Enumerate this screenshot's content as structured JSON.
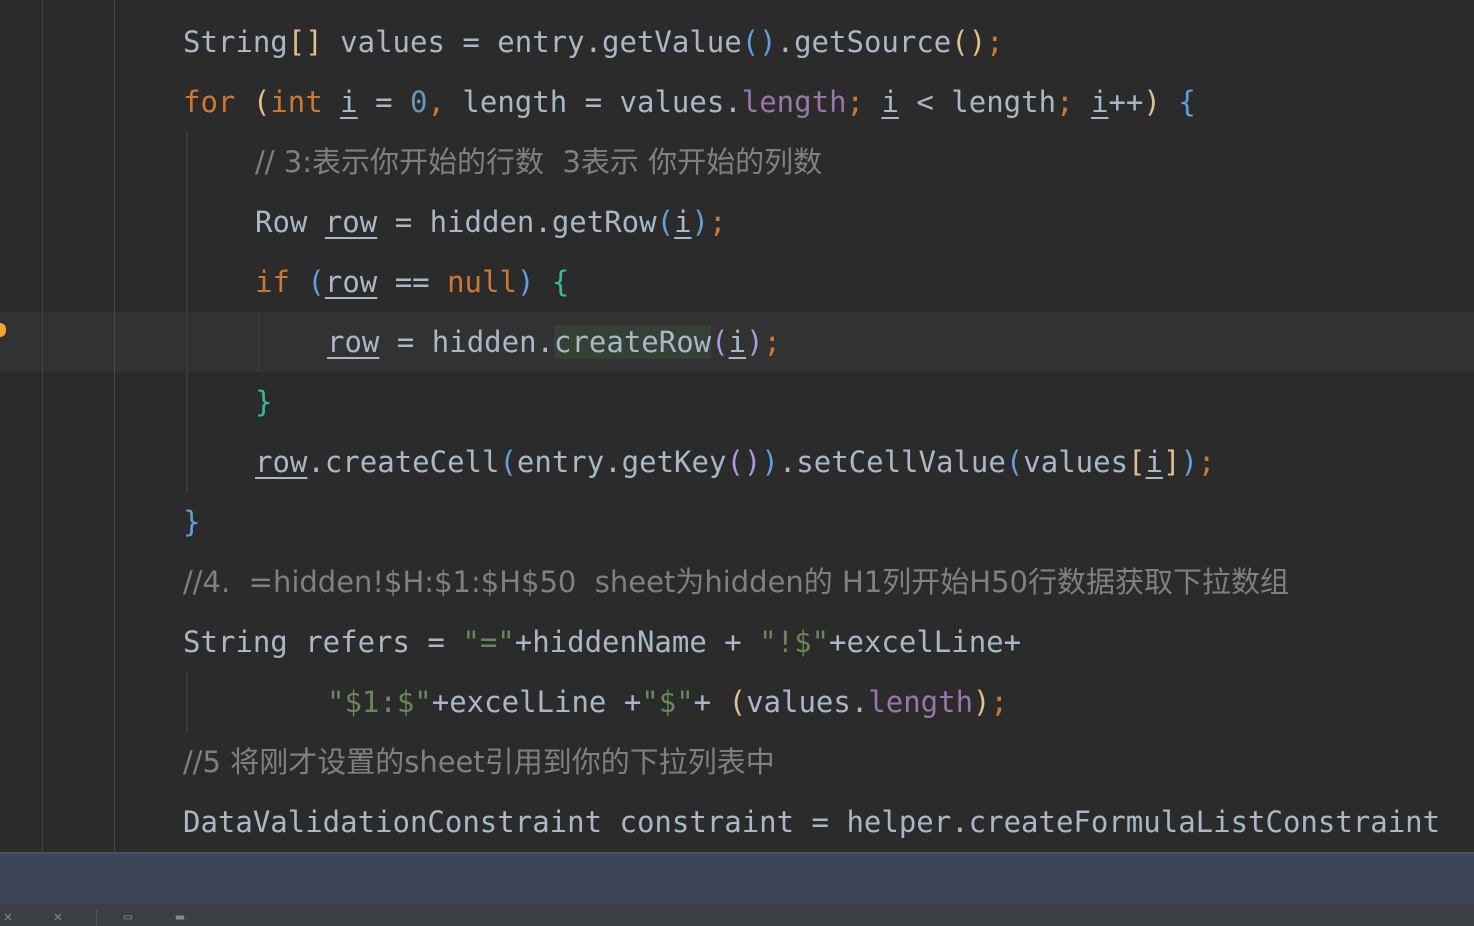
{
  "code_lines": [
    [
      {
        "t": "String",
        "c": ""
      },
      {
        "t": "[]",
        "c": "p1"
      },
      {
        "t": " values = entry.getValue",
        "c": ""
      },
      {
        "t": "()",
        "c": "p2"
      },
      {
        "t": ".getSource",
        "c": ""
      },
      {
        "t": "()",
        "c": "p1"
      },
      {
        "t": ";",
        "c": "kw"
      }
    ],
    [
      {
        "t": "for ",
        "c": "kw"
      },
      {
        "t": "(",
        "c": "p1"
      },
      {
        "t": "int ",
        "c": "kw"
      },
      {
        "t": "i",
        "c": "ul"
      },
      {
        "t": " = ",
        "c": ""
      },
      {
        "t": "0",
        "c": "num"
      },
      {
        "t": ", ",
        "c": "kw"
      },
      {
        "t": "length = values.",
        "c": ""
      },
      {
        "t": "length",
        "c": "fld"
      },
      {
        "t": "; ",
        "c": "kw"
      },
      {
        "t": "i",
        "c": "ul"
      },
      {
        "t": " < length",
        "c": ""
      },
      {
        "t": "; ",
        "c": "kw"
      },
      {
        "t": "i",
        "c": "ul"
      },
      {
        "t": "++",
        "c": ""
      },
      {
        "t": ")",
        "c": "p1"
      },
      {
        "t": " ",
        "c": ""
      },
      {
        "t": "{",
        "c": "p2"
      }
    ],
    [
      {
        "t": "// 3:表示你开始的行数  3表示 你开始的列数",
        "c": "cmt"
      }
    ],
    [
      {
        "t": "Row ",
        "c": ""
      },
      {
        "t": "row",
        "c": "ul"
      },
      {
        "t": " = hidden.getRow",
        "c": ""
      },
      {
        "t": "(",
        "c": "p2"
      },
      {
        "t": "i",
        "c": "ul"
      },
      {
        "t": ")",
        "c": "p2"
      },
      {
        "t": ";",
        "c": "kw"
      }
    ],
    [
      {
        "t": "if ",
        "c": "kw"
      },
      {
        "t": "(",
        "c": "p2"
      },
      {
        "t": "row",
        "c": "ul"
      },
      {
        "t": " == ",
        "c": ""
      },
      {
        "t": "null",
        "c": "kw"
      },
      {
        "t": ")",
        "c": "p2"
      },
      {
        "t": " ",
        "c": ""
      },
      {
        "t": "{",
        "c": "p4"
      }
    ],
    [
      {
        "t": "row",
        "c": "ul"
      },
      {
        "t": " = hidden.",
        "c": ""
      },
      {
        "t": "createRow",
        "c": "hl"
      },
      {
        "t": "(",
        "c": "p3"
      },
      {
        "t": "i",
        "c": "ul"
      },
      {
        "t": ")",
        "c": "p3"
      },
      {
        "t": ";",
        "c": "kw"
      }
    ],
    [
      {
        "t": "}",
        "c": "p4"
      }
    ],
    [
      {
        "t": "row",
        "c": "ul"
      },
      {
        "t": ".createCell",
        "c": ""
      },
      {
        "t": "(",
        "c": "p2"
      },
      {
        "t": "entry.getKey",
        "c": ""
      },
      {
        "t": "()",
        "c": "p3"
      },
      {
        "t": ")",
        "c": "p2"
      },
      {
        "t": ".setCellValue",
        "c": ""
      },
      {
        "t": "(",
        "c": "p2"
      },
      {
        "t": "values",
        "c": ""
      },
      {
        "t": "[",
        "c": "p1"
      },
      {
        "t": "i",
        "c": "ul"
      },
      {
        "t": "]",
        "c": "p1"
      },
      {
        "t": ")",
        "c": "p2"
      },
      {
        "t": ";",
        "c": "kw"
      }
    ],
    [
      {
        "t": "}",
        "c": "p2"
      }
    ],
    [
      {
        "t": "//4.  =hidden!$H:$1:$H$50  sheet为hidden的 H1列开始H50行数据获取下拉数组",
        "c": "cmt"
      }
    ],
    [
      {
        "t": "String refers = ",
        "c": ""
      },
      {
        "t": "\"=\"",
        "c": "str"
      },
      {
        "t": "+hiddenName + ",
        "c": ""
      },
      {
        "t": "\"!$\"",
        "c": "str"
      },
      {
        "t": "+excelLine+",
        "c": ""
      }
    ],
    [
      {
        "t": "\"$1:$\"",
        "c": "str"
      },
      {
        "t": "+excelLine +",
        "c": ""
      },
      {
        "t": "\"$\"",
        "c": "str"
      },
      {
        "t": "+ ",
        "c": ""
      },
      {
        "t": "(",
        "c": "p1"
      },
      {
        "t": "values.",
        "c": ""
      },
      {
        "t": "length",
        "c": "fld"
      },
      {
        "t": ")",
        "c": "p1"
      },
      {
        "t": ";",
        "c": "kw"
      }
    ],
    [
      {
        "t": "//5 将刚才设置的sheet引用到你的下拉列表中",
        "c": "cmt"
      }
    ],
    [
      {
        "t": "DataValidationConstraint constraint = helper.createFormulaListConstraint",
        "c": ""
      }
    ]
  ],
  "icons": [
    "lightbulb-icon",
    "close-icon",
    "pin-icon",
    "window-icon",
    "layout-icon"
  ]
}
